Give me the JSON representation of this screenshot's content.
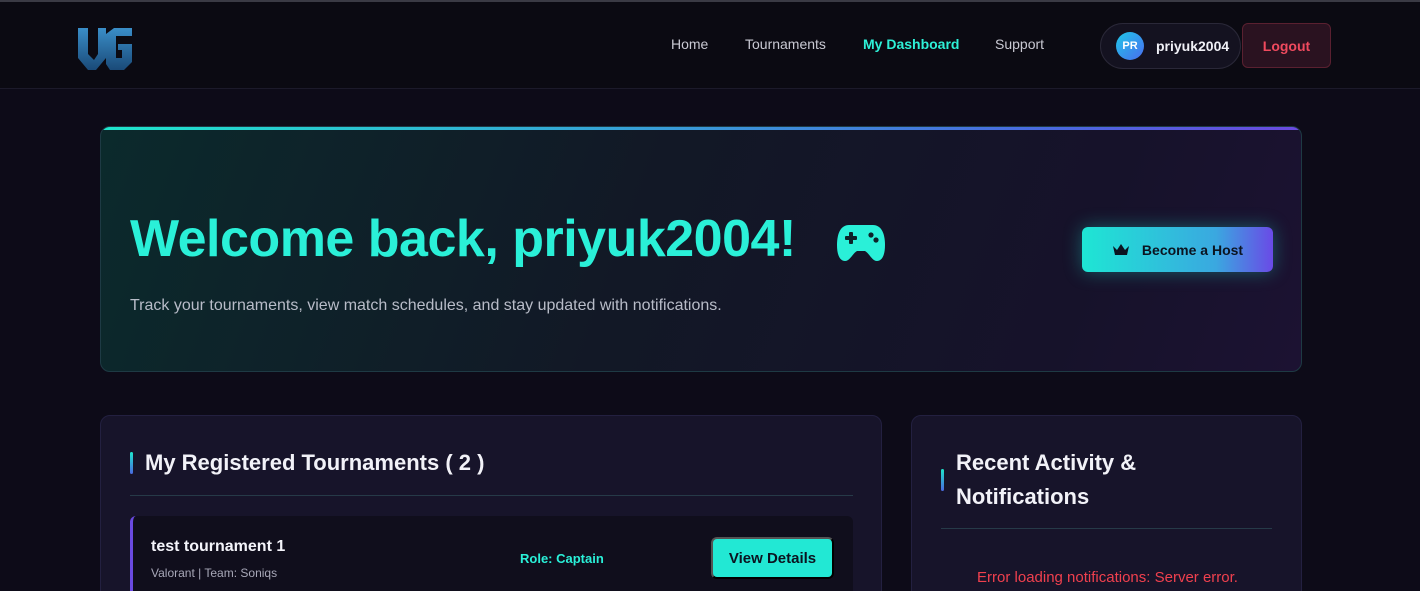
{
  "nav": {
    "items": [
      {
        "label": "Home",
        "active": false
      },
      {
        "label": "Tournaments",
        "active": false
      },
      {
        "label": "My Dashboard",
        "active": true
      },
      {
        "label": "Support",
        "active": false
      }
    ]
  },
  "user": {
    "initials": "PR",
    "username": "priyuk2004",
    "logout_label": "Logout"
  },
  "hero": {
    "title": "Welcome back, priyuk2004!",
    "subtitle": "Track your tournaments, view match schedules, and stay updated with notifications.",
    "host_button_label": "Become a Host",
    "icon": "gamepad-icon"
  },
  "tournaments": {
    "title": "My Registered Tournaments ( 2 )",
    "items": [
      {
        "name": "test tournament 1",
        "meta": "Valorant | Team: Soniqs",
        "role": "Role: Captain",
        "button_label": "View Details"
      }
    ]
  },
  "activity": {
    "title_line1": "Recent Activity &",
    "title_line2": "Notifications",
    "error": "Error loading notifications: Server error."
  },
  "colors": {
    "accent": "#2af0d8",
    "background": "#0d0b18",
    "danger": "#f0404e",
    "purple": "#6a4ae0"
  }
}
